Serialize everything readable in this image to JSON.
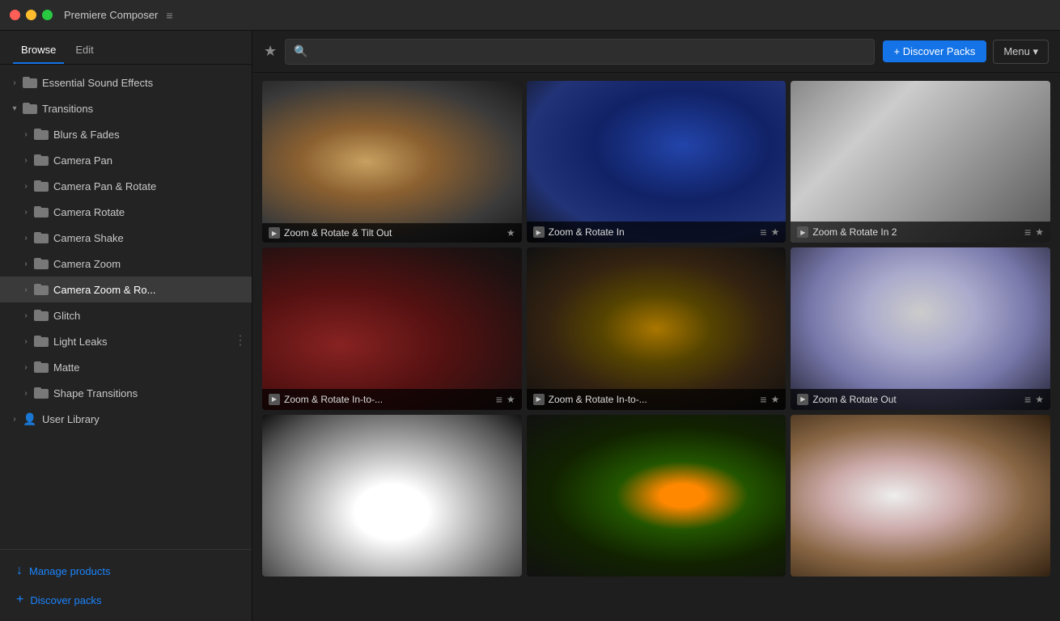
{
  "titlebar": {
    "app_name": "Premiere Composer",
    "hamburger": "≡"
  },
  "tabs": [
    {
      "id": "browse",
      "label": "Browse",
      "active": true
    },
    {
      "id": "edit",
      "label": "Edit",
      "active": false
    }
  ],
  "header": {
    "discover_btn": "+ Discover Packs",
    "menu_btn": "Menu",
    "search_placeholder": ""
  },
  "sidebar": {
    "items": [
      {
        "id": "essential-sound",
        "label": "Essential Sound Effects",
        "level": 0,
        "type": "folder",
        "expanded": false,
        "active": false
      },
      {
        "id": "transitions",
        "label": "Transitions",
        "level": 0,
        "type": "folder",
        "expanded": true,
        "active": false
      },
      {
        "id": "blurs-fades",
        "label": "Blurs & Fades",
        "level": 1,
        "type": "folder",
        "expanded": false,
        "active": false
      },
      {
        "id": "camera-pan",
        "label": "Camera Pan",
        "level": 1,
        "type": "folder",
        "expanded": false,
        "active": false
      },
      {
        "id": "camera-pan-rotate",
        "label": "Camera Pan & Rotate",
        "level": 1,
        "type": "folder",
        "expanded": false,
        "active": false
      },
      {
        "id": "camera-rotate",
        "label": "Camera Rotate",
        "level": 1,
        "type": "folder",
        "expanded": false,
        "active": false
      },
      {
        "id": "camera-shake",
        "label": "Camera Shake",
        "level": 1,
        "type": "folder",
        "expanded": false,
        "active": false
      },
      {
        "id": "camera-zoom",
        "label": "Camera Zoom",
        "level": 1,
        "type": "folder",
        "expanded": false,
        "active": false
      },
      {
        "id": "camera-zoom-ro",
        "label": "Camera Zoom & Ro...",
        "level": 1,
        "type": "folder",
        "expanded": false,
        "active": true
      },
      {
        "id": "glitch",
        "label": "Glitch",
        "level": 1,
        "type": "folder",
        "expanded": false,
        "active": false
      },
      {
        "id": "light-leaks",
        "label": "Light Leaks",
        "level": 1,
        "type": "folder",
        "expanded": false,
        "active": false,
        "has_dots": true
      },
      {
        "id": "matte",
        "label": "Matte",
        "level": 1,
        "type": "folder",
        "expanded": false,
        "active": false
      },
      {
        "id": "shape-transitions",
        "label": "Shape Transitions",
        "level": 1,
        "type": "folder",
        "expanded": false,
        "active": false
      },
      {
        "id": "user-library",
        "label": "User Library",
        "level": 0,
        "type": "person",
        "expanded": false,
        "active": false
      }
    ],
    "footer": [
      {
        "id": "manage-products",
        "label": "Manage products",
        "icon": "↓"
      },
      {
        "id": "discover-packs",
        "label": "Discover packs",
        "icon": "+"
      }
    ]
  },
  "grid": {
    "items": [
      {
        "id": 1,
        "label": "Zoom & Rotate & Tilt Out",
        "starred": false,
        "img_class": "img-1"
      },
      {
        "id": 2,
        "label": "Zoom & Rotate In",
        "starred": false,
        "img_class": "img-2"
      },
      {
        "id": 3,
        "label": "Zoom & Rotate In 2",
        "starred": false,
        "img_class": "img-3"
      },
      {
        "id": 4,
        "label": "Zoom & Rotate In-to-...",
        "starred": false,
        "img_class": "img-4"
      },
      {
        "id": 5,
        "label": "Zoom & Rotate In-to-...",
        "starred": false,
        "img_class": "img-5"
      },
      {
        "id": 6,
        "label": "Zoom & Rotate Out",
        "starred": false,
        "img_class": "img-6"
      },
      {
        "id": 7,
        "label": "",
        "starred": false,
        "img_class": "img-7"
      },
      {
        "id": 8,
        "label": "",
        "starred": false,
        "img_class": "img-8"
      },
      {
        "id": 9,
        "label": "",
        "starred": false,
        "img_class": "img-9"
      }
    ]
  }
}
